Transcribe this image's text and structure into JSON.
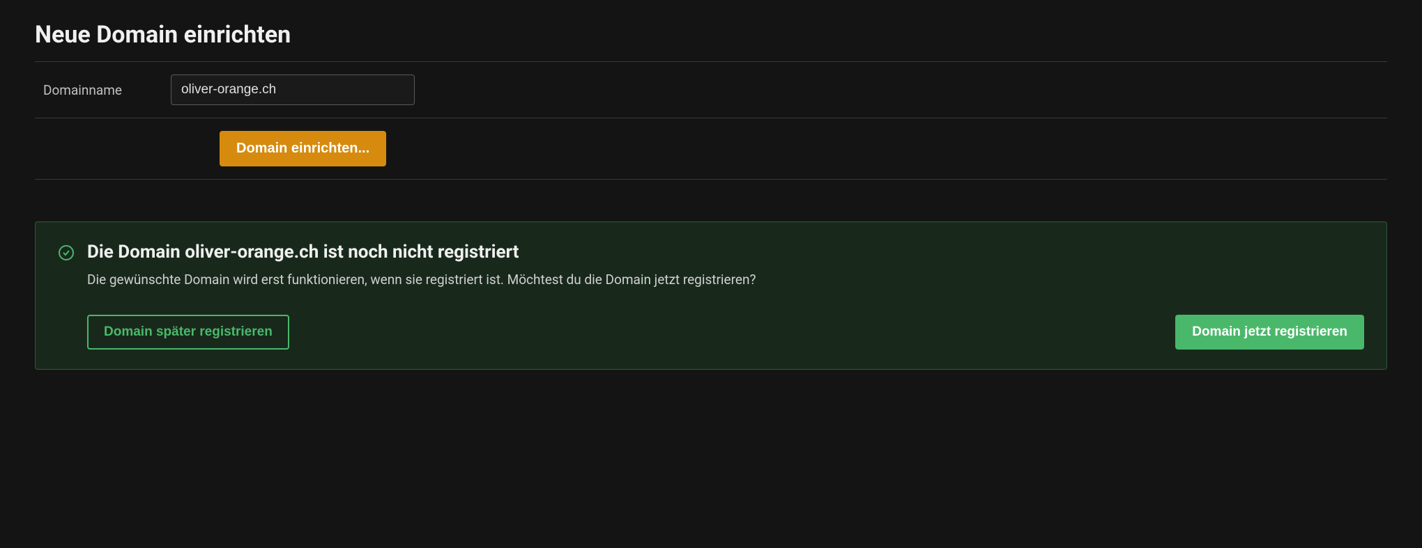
{
  "header": {
    "title": "Neue Domain einrichten"
  },
  "form": {
    "domain_label": "Domainname",
    "domain_value": "oliver-orange.ch",
    "submit_label": "Domain einrichten..."
  },
  "alert": {
    "title": "Die Domain oliver-orange.ch ist noch nicht registriert",
    "description": "Die gewünschte Domain wird erst funktionieren, wenn sie registriert ist. Möchtest du die Domain jetzt registrieren?",
    "later_label": "Domain später registrieren",
    "now_label": "Domain jetzt registrieren"
  },
  "colors": {
    "accent_orange": "#d68b0f",
    "accent_green": "#4ab86a",
    "alert_bg": "#18291c"
  }
}
